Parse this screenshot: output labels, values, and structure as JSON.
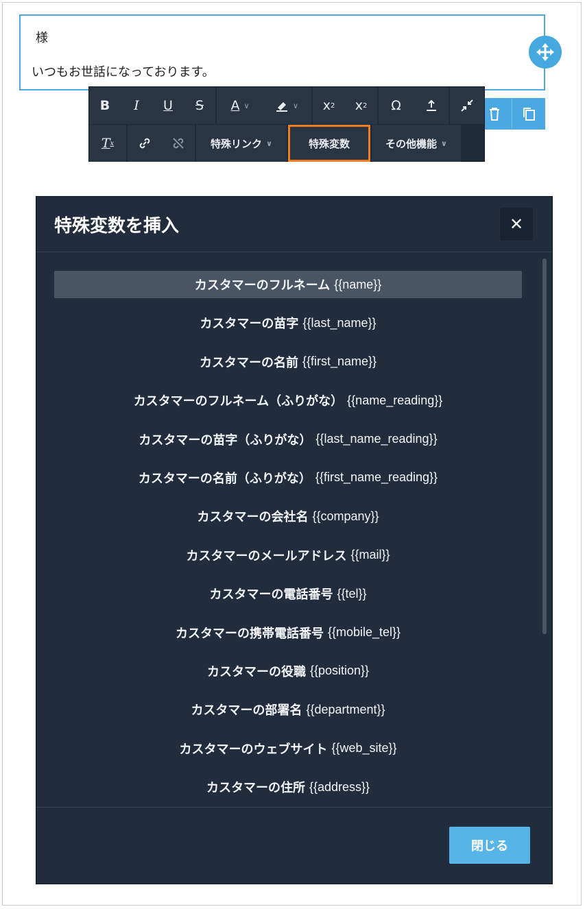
{
  "editor": {
    "line1": "様",
    "line2": "いつもお世話になっております。"
  },
  "toolbar": {
    "special_link_label": "特殊リンク",
    "special_var_label": "特殊変数",
    "other_label": "その他機能"
  },
  "modal": {
    "title": "特殊変数を挿入",
    "close_label": "閉じる",
    "items": [
      {
        "label": "カスタマーのフルネーム",
        "code": "{{name}}"
      },
      {
        "label": "カスタマーの苗字",
        "code": "{{last_name}}"
      },
      {
        "label": "カスタマーの名前",
        "code": "{{first_name}}"
      },
      {
        "label": "カスタマーのフルネーム（ふりがな）",
        "code": "{{name_reading}}"
      },
      {
        "label": "カスタマーの苗字（ふりがな）",
        "code": "{{last_name_reading}}"
      },
      {
        "label": "カスタマーの名前（ふりがな）",
        "code": "{{first_name_reading}}"
      },
      {
        "label": "カスタマーの会社名",
        "code": "{{company}}"
      },
      {
        "label": "カスタマーのメールアドレス",
        "code": "{{mail}}"
      },
      {
        "label": "カスタマーの電話番号",
        "code": "{{tel}}"
      },
      {
        "label": "カスタマーの携帯電話番号",
        "code": "{{mobile_tel}}"
      },
      {
        "label": "カスタマーの役職",
        "code": "{{position}}"
      },
      {
        "label": "カスタマーの部署名",
        "code": "{{department}}"
      },
      {
        "label": "カスタマーのウェブサイト",
        "code": "{{web_site}}"
      },
      {
        "label": "カスタマーの住所",
        "code": "{{address}}"
      }
    ]
  },
  "colors": {
    "accent": "#4aa9e3",
    "modal_bg": "#212d3c",
    "highlight_border": "#ee7d22"
  }
}
